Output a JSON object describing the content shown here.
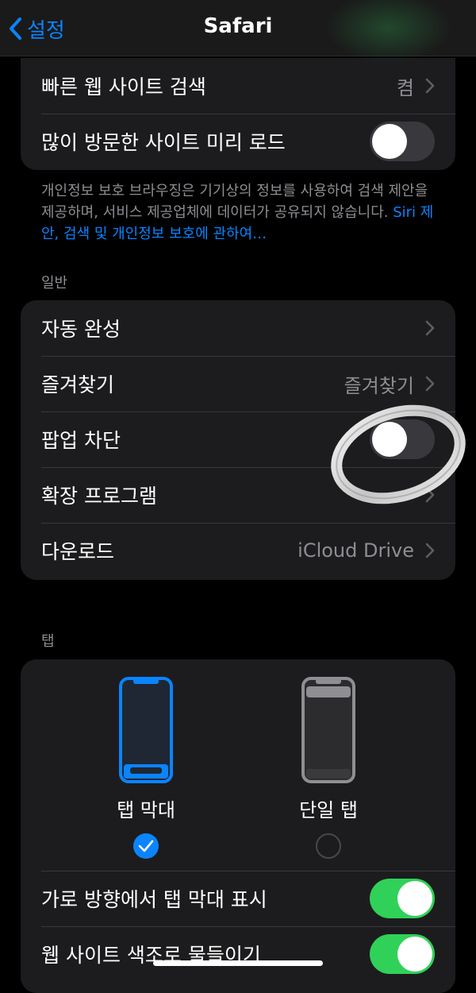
{
  "navbar": {
    "back_label": "설정",
    "title": "Safari"
  },
  "top_group": {
    "rows": [
      {
        "label": "빠른 웹 사이트 검색",
        "value": "켬"
      },
      {
        "label": "많이 방문한 사이트 미리 로드",
        "toggle_on": false
      }
    ]
  },
  "privacy_footnote": {
    "text": "개인정보 보호 브라우징은 기기상의 정보를 사용하여 검색 제안을 제공하며, 서비스 제공업체에 데이터가 공유되지 않습니다.",
    "link": "Siri 제안, 검색 및 개인정보 보호에 관하여…"
  },
  "general": {
    "header": "일반",
    "rows": [
      {
        "label": "자동 완성",
        "value": ""
      },
      {
        "label": "즐겨찾기",
        "value": "즐겨찾기"
      },
      {
        "label": "팝업 차단",
        "toggle_on": false
      },
      {
        "label": "확장 프로그램",
        "value": ""
      },
      {
        "label": "다운로드",
        "value": "iCloud Drive"
      }
    ]
  },
  "tabs": {
    "header": "탭",
    "options": [
      {
        "label": "탭 막대",
        "selected": true
      },
      {
        "label": "단일 탭",
        "selected": false
      }
    ],
    "rows": [
      {
        "label": "가로 방향에서 탭 막대 표시",
        "toggle_on": true
      },
      {
        "label": "웹 사이트 색조로 물들이기",
        "toggle_on": true
      }
    ]
  },
  "colors": {
    "accent": "#0a84ff",
    "toggle_on": "#30d158",
    "toggle_off": "#39393d",
    "card": "#1c1c1e",
    "secondary_text": "#8d8d93"
  }
}
